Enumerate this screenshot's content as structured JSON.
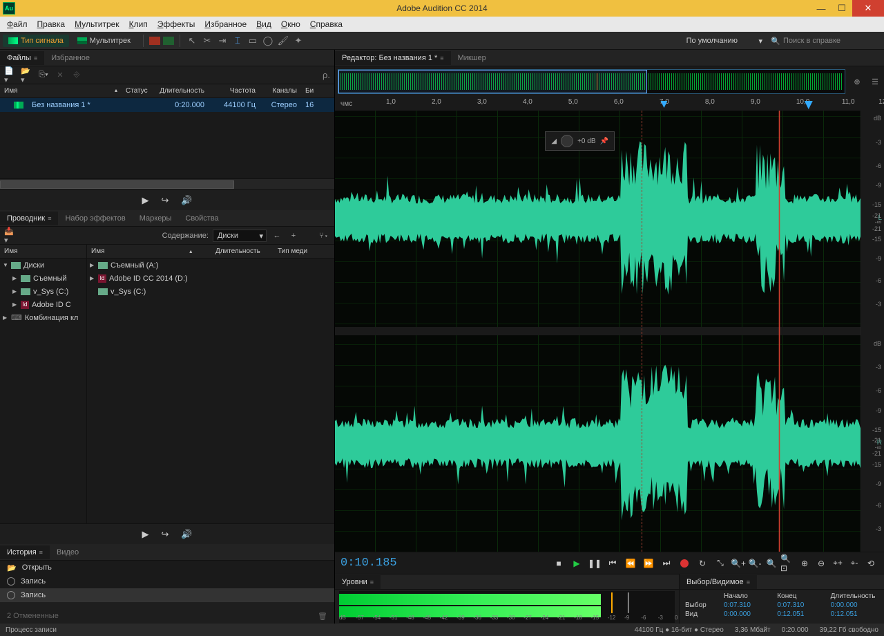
{
  "app": {
    "title": "Adobe Audition CC 2014",
    "logo": "Au"
  },
  "menu": {
    "file": "Файл",
    "edit": "Правка",
    "multitrack": "Мультитрек",
    "clip": "Клип",
    "effects": "Эффекты",
    "favorites": "Избранное",
    "view": "Вид",
    "window": "Окно",
    "help": "Справка"
  },
  "modebar": {
    "waveform": "Тип сигнала",
    "multitrack": "Мультитрек",
    "workspace": "По умолчанию",
    "search": "Поиск в справке"
  },
  "files": {
    "tab": "Файлы",
    "fav": "Избранное",
    "cols": {
      "name": "Имя",
      "status": "Статус",
      "duration": "Длительность",
      "freq": "Частота",
      "channels": "Каналы",
      "bit": "Би"
    },
    "row": {
      "name": "Без названия 1 *",
      "dur": "0:20.000",
      "freq": "44100 Гц",
      "ch": "Стерео",
      "bit": "16"
    }
  },
  "provider": {
    "tab": "Проводник",
    "fx": "Набор эффектов",
    "markers": "Маркеры",
    "props": "Свойства",
    "content_label": "Содержание:",
    "content_value": "Диски",
    "tree_hdr": "Имя",
    "list_hdr_name": "Имя",
    "list_hdr_dur": "Длительность",
    "list_hdr_media": "Тип меди",
    "disks": "Диски",
    "combo": "Комбинация кл",
    "drive_a": "Съемный (A:)",
    "drive_a_short": "Съемный",
    "drive_d": "Adobe ID CC 2014 (D:)",
    "drive_d_short": "Adobe ID C",
    "drive_c": "v_Sys (C:)",
    "drive_c_short": "v_Sys (C:)"
  },
  "history": {
    "tab": "История",
    "video": "Видео",
    "open": "Открыть",
    "record": "Запись",
    "undo": "2 Отмененные"
  },
  "editor": {
    "tab": "Редактор: Без названия 1 *",
    "mixer": "Микшер",
    "hms": "чмс",
    "hud_db": "+0 dB",
    "ticks": [
      "1,0",
      "2,0",
      "3,0",
      "4,0",
      "5,0",
      "6,0",
      "7,0",
      "8,0",
      "9,0",
      "10,0",
      "11,0",
      "12"
    ],
    "db_ticks": [
      "dB",
      "-3",
      "-6",
      "-9",
      "-15",
      "-21",
      "-∞",
      "-21",
      "-15",
      "-9",
      "-6",
      "-3"
    ],
    "ch_l": "L",
    "ch_r": "R"
  },
  "transport": {
    "time": "0:10.185"
  },
  "levels": {
    "tab": "Уровни",
    "ruler": [
      "dB",
      "-57",
      "-54",
      "-51",
      "-48",
      "-45",
      "-42",
      "-39",
      "-36",
      "-33",
      "-30",
      "-27",
      "-24",
      "-21",
      "-18",
      "-15",
      "-12",
      "-9",
      "-6",
      "-3",
      "0"
    ]
  },
  "selview": {
    "tab": "Выбор/Видимое",
    "start": "Начало",
    "end": "Конец",
    "dur": "Длительность",
    "sel": "Выбор",
    "view": "Вид",
    "sel_start": "0:07.310",
    "sel_end": "0:07.310",
    "sel_dur": "0:00.000",
    "view_start": "0:00.000",
    "view_end": "0:12.051",
    "view_dur": "0:12.051"
  },
  "status": {
    "process": "Процесс записи",
    "fmt": "44100 Гц ● 16-бит ● Стерео",
    "size": "3,36 Мбайт",
    "dur": "0:20.000",
    "free": "39,22 Гб свободно"
  }
}
